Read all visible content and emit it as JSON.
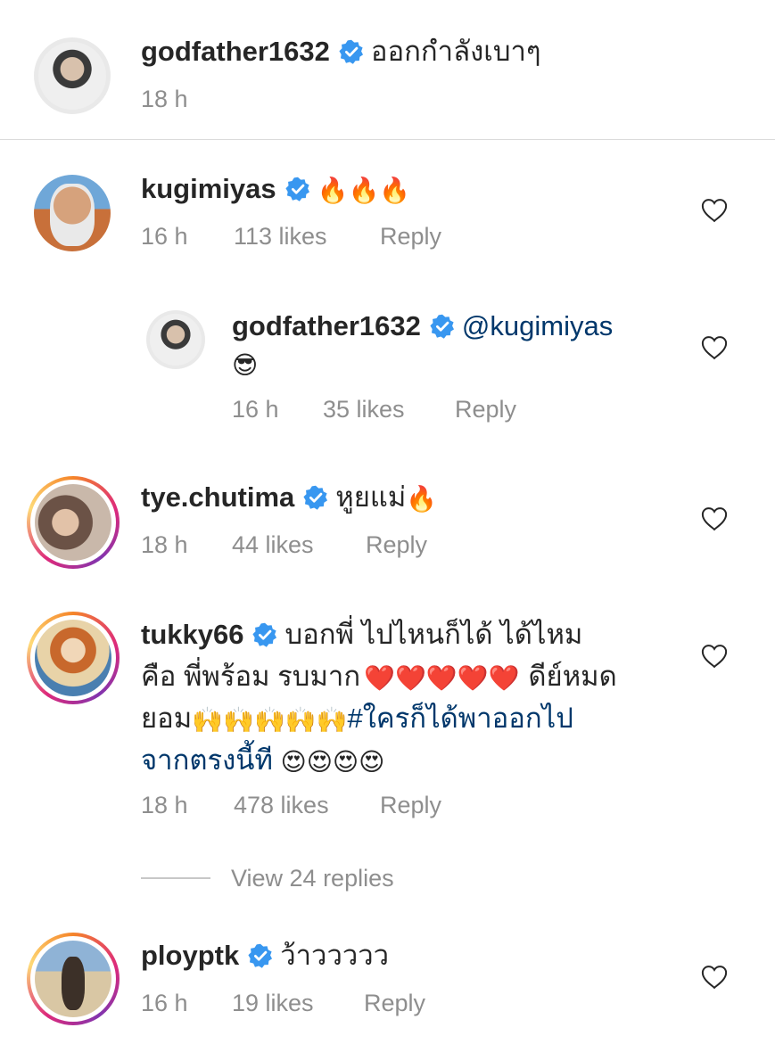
{
  "caption": {
    "username": "godfather1632",
    "text": "ออกกำลังเบาๆ",
    "time": "18 h"
  },
  "comments": [
    {
      "username": "kugimiyas",
      "text": "",
      "emoji": "🔥🔥🔥",
      "time": "16 h",
      "likes": "113 likes",
      "reply": "Reply"
    },
    {
      "username": "godfather1632",
      "mention": "@kugimiyas",
      "emoji": "😎",
      "time": "16 h",
      "likes": "35 likes",
      "reply": "Reply"
    },
    {
      "username": "tye.chutima",
      "text": "หูยแม่",
      "emoji": "🔥",
      "time": "18 h",
      "likes": "44 likes",
      "reply": "Reply"
    },
    {
      "username": "tukky66",
      "line1": "บอกพี่ ไปไหนก็ได้ ได้ไหม",
      "line2a": "คือ พี่พร้อม รบมาก",
      "hearts": "❤️❤️❤️❤️❤️",
      "line2b": "ดีย์หมด",
      "line3a": "ยอม",
      "hands": "🙌🙌🙌🙌🙌",
      "hashtag1": "#ใครก็ได้พาออกไป",
      "hashtag2": "จากตรงนี้ที",
      "eyes": "😍😍😍😍",
      "time": "18 h",
      "likes": "478 likes",
      "reply": "Reply",
      "view_replies": "View 24 replies"
    },
    {
      "username": "ploypt k",
      "display_username": "ployptk",
      "text": "ว้าววววว",
      "time": "16 h",
      "likes": "19 likes",
      "reply": "Reply"
    }
  ],
  "icons": {
    "verified": "verified-badge-icon",
    "like": "heart-outline-icon"
  },
  "colors": {
    "verified": "#3897f0",
    "meta": "#8e8e8e",
    "link": "#00376b"
  }
}
